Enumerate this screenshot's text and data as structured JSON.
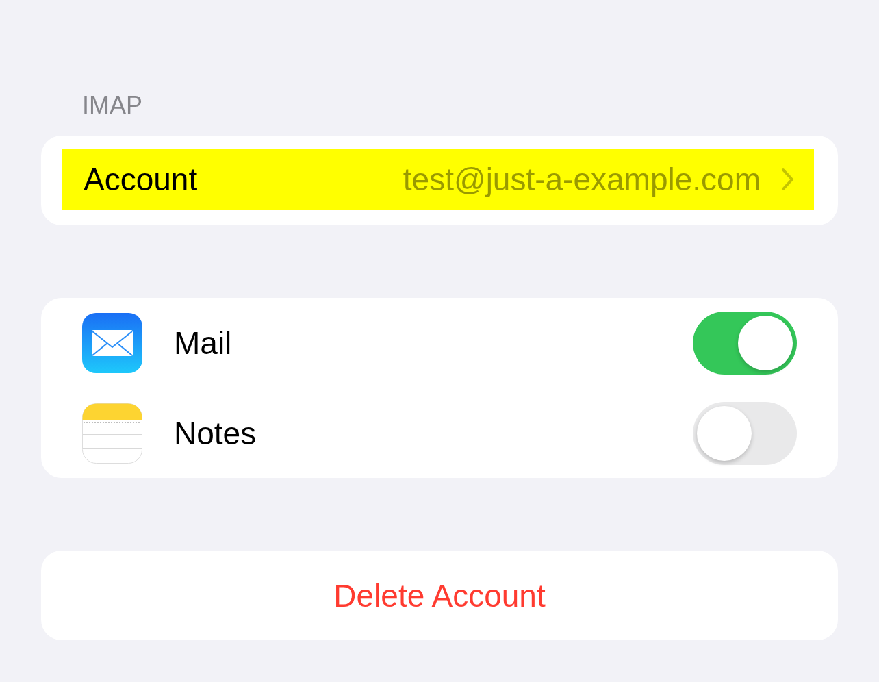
{
  "section_header": "IMAP",
  "account_row": {
    "label": "Account",
    "value": "test@just-a-example.com",
    "highlighted": true
  },
  "apps": [
    {
      "kind": "mail",
      "label": "Mail",
      "on": true
    },
    {
      "kind": "notes",
      "label": "Notes",
      "on": false
    }
  ],
  "delete_button": "Delete Account"
}
